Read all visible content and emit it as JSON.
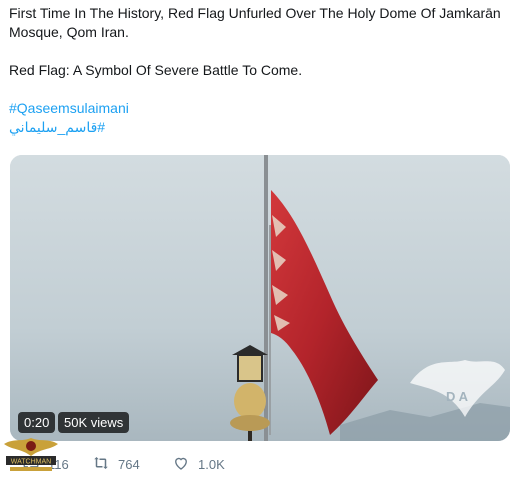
{
  "tweet": {
    "line1": "First Time In The History, Red Flag Unfurled Over The Holy Dome Of Jamkarān",
    "line2": "Mosque, Qom Iran.",
    "line3": "Red Flag: A Symbol Of Severe Battle To Come.",
    "hashtag1": "#Qaseemsulaimani",
    "hashtag2": "#قاسم_سليماني",
    "link_color": "#1da1f2"
  },
  "video": {
    "duration": "0:20",
    "views": "50K views",
    "flag_color": "#c0282d",
    "watermark_text": "D A"
  },
  "actions": {
    "reply_count": "116",
    "retweet_count": "764",
    "like_count": "1.0K",
    "reply_icon": "reply-icon",
    "retweet_icon": "retweet-icon",
    "like_icon": "heart-icon"
  },
  "overlay_logo": {
    "text": "WATCHMAN"
  }
}
